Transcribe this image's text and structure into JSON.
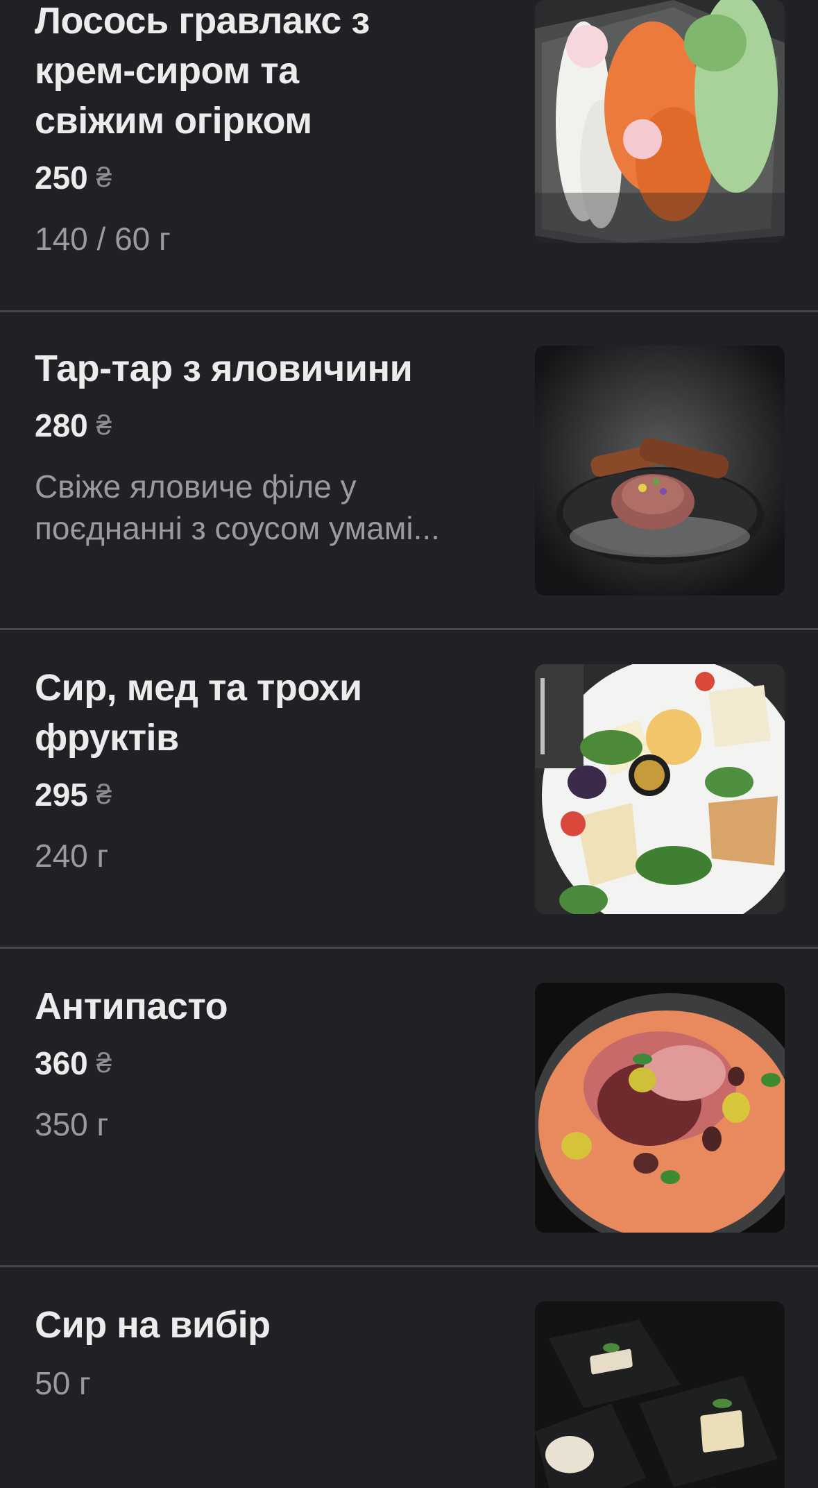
{
  "menu": {
    "items": [
      {
        "name_lines": [
          "Лосось гравлакс з",
          "крем-сиром та",
          "свіжим огірком"
        ],
        "price": "250",
        "currency": "₴",
        "weight": "140 / 60 г",
        "photo": "salmon-gravlax-photo"
      },
      {
        "name_lines": [
          "Тар-тар з яловичини"
        ],
        "price": "280",
        "currency": "₴",
        "description_lines": [
          "Свіже яловиче філе у",
          "поєднанні з соусом умамі..."
        ],
        "photo": "beef-tartare-photo"
      },
      {
        "name_lines": [
          "Сир, мед та трохи",
          "фруктів"
        ],
        "price": "295",
        "currency": "₴",
        "weight": "240 г",
        "photo": "cheese-honey-fruit-photo"
      },
      {
        "name_lines": [
          "Антипасто"
        ],
        "price": "360",
        "currency": "₴",
        "weight": "350 г",
        "photo": "antipasto-photo"
      },
      {
        "name_lines": [
          "Сир на вибір"
        ],
        "weight": "50 г",
        "photo": "cheese-choice-photo"
      }
    ]
  },
  "colors": {
    "background": "#1f2125",
    "text_primary": "#ececec",
    "text_secondary": "#9a9ba0",
    "divider": "#45474d"
  }
}
